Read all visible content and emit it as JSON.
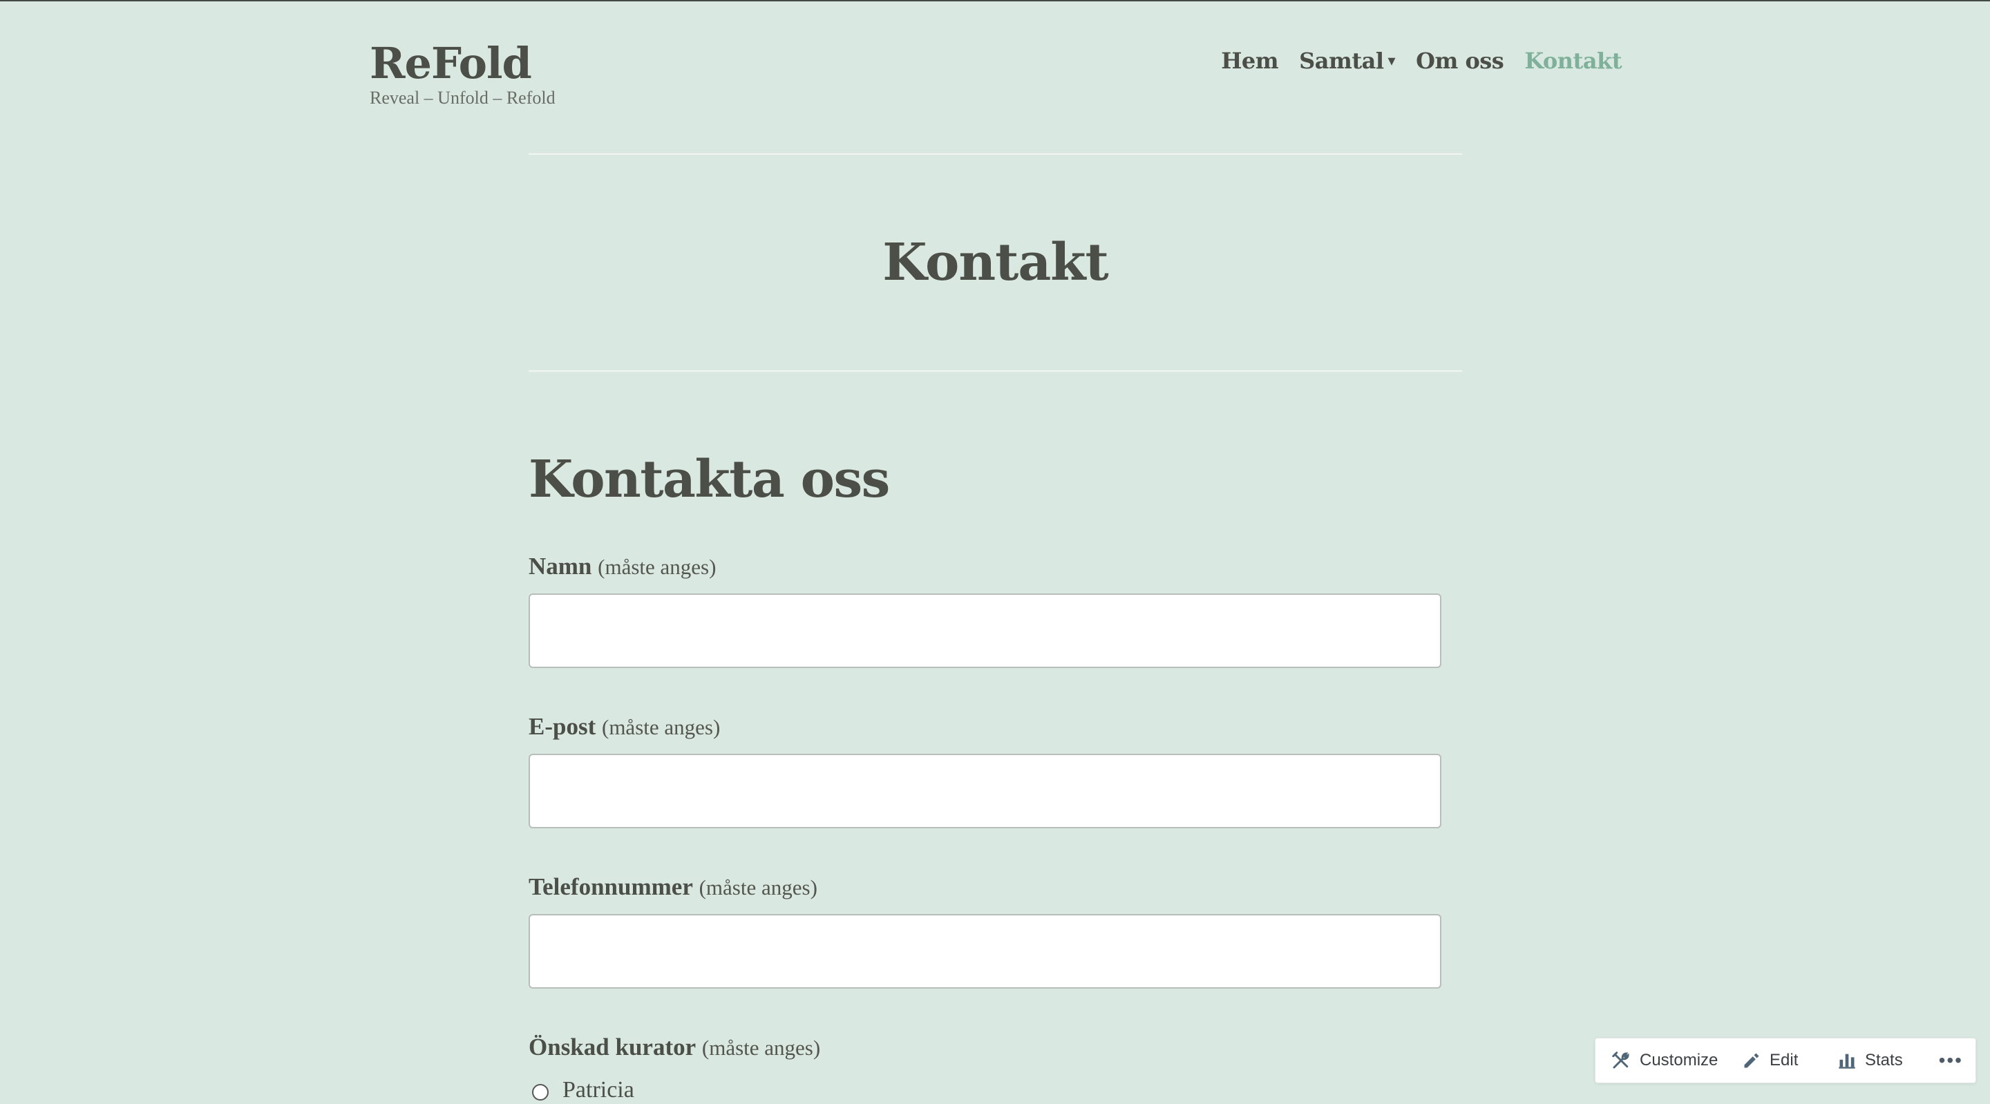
{
  "site": {
    "title": "ReFold",
    "tagline": "Reveal – Unfold – Refold"
  },
  "nav": {
    "items": [
      {
        "label": "Hem"
      },
      {
        "label": "Samtal",
        "caret": "▾"
      },
      {
        "label": "Om oss"
      },
      {
        "label": "Kontakt",
        "current": true
      }
    ],
    "current_color": "#7fb09a"
  },
  "page": {
    "title": "Kontakt"
  },
  "form": {
    "heading": "Kontakta oss",
    "required_text": "(måste anges)",
    "fields": [
      {
        "label": "Namn",
        "value": ""
      },
      {
        "label": "E-post",
        "value": ""
      },
      {
        "label": "Telefonnummer",
        "value": ""
      }
    ],
    "radio_group": {
      "label": "Önskad kurator",
      "options": [
        {
          "label": "Patricia",
          "checked": false
        }
      ]
    }
  },
  "admin_bar": {
    "customize": "Customize",
    "edit": "Edit",
    "stats": "Stats",
    "more": "•••"
  },
  "colors": {
    "background": "#d9e8e1",
    "text": "#4c4e48",
    "accent": "#7fb09a"
  }
}
